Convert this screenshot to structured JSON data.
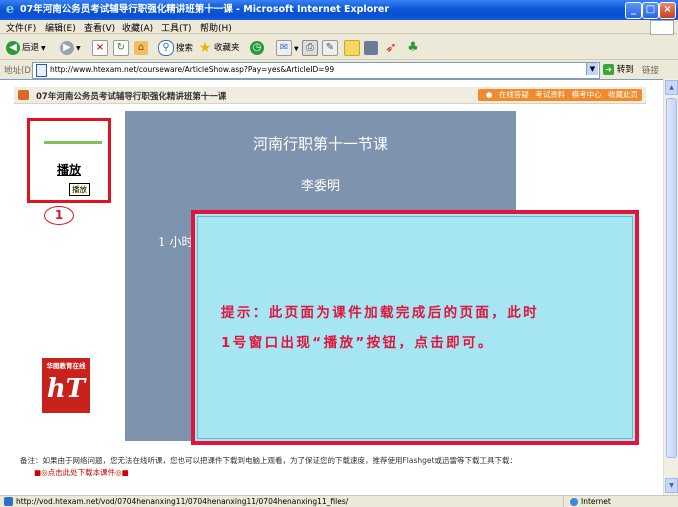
{
  "window": {
    "title": "07年河南公务员考试辅导行职强化精讲班第十一课 - Microsoft Internet Explorer",
    "controls": {
      "minimize": "_",
      "maximize": "□",
      "close": "×"
    }
  },
  "menu": [
    "文件(F)",
    "编辑(E)",
    "查看(V)",
    "收藏(A)",
    "工具(T)",
    "帮助(H)"
  ],
  "toolbar": {
    "back": "后退",
    "search": "搜索",
    "favorites": "收藏夹"
  },
  "address": {
    "label": "地址(D)",
    "url": "http://www.htexam.net/courseware/ArticleShow.asp?Pay=yes&ArticleID=99",
    "go": "转到",
    "links": "链接"
  },
  "course": {
    "header_title": "07年河南公务员考试辅导行职强化精讲班第十一课",
    "nav": [
      "在线答疑",
      "考试资料",
      "模考中心",
      "收藏此页"
    ],
    "play_label": "播放",
    "play_tooltip": "播放",
    "marker": "1",
    "logo_top": "华图教育在线",
    "logo_text": "hT"
  },
  "slide": {
    "title": "河南行职第十一节课",
    "author": "李委明",
    "line": "1 小时"
  },
  "notice": {
    "line1": "提示：此页面为课件加载完成后的页面，此时",
    "line2": "1号窗口出现“播放”按钮，点击即可。"
  },
  "footer": {
    "note": "备注：如果由于网络问题，您无法在线听课，您也可以把课件下载到电脑上观看，为了保证您的下载速度，推荐使用Flashget或迅雷等下载工具下载：",
    "download_link": "■◎点击此处下载本课件◎■"
  },
  "status": {
    "text": "http://vod.htexam.net/vod/0704henanxing11/0704henanxing11/0704henanxing11_files/",
    "zone": "Internet"
  },
  "colors": {
    "highlight_red": "#e0141e",
    "notice_bg": "#a6e5f2",
    "slide_bg": "#7e93ad"
  }
}
